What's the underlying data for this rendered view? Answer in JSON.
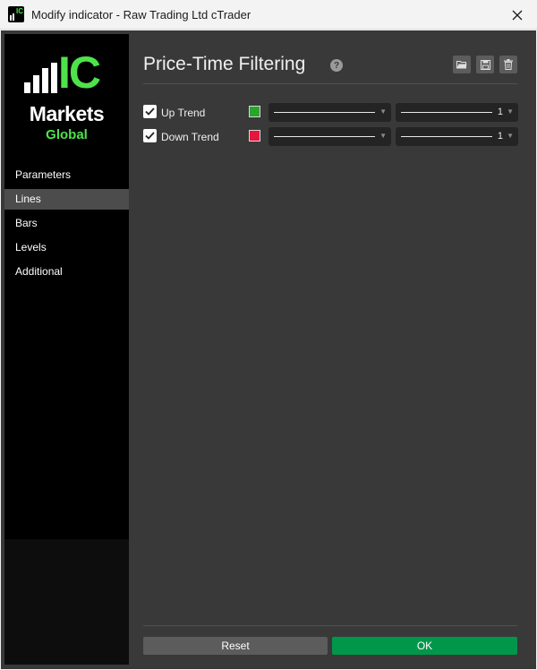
{
  "window": {
    "title": "Modify indicator - Raw Trading Ltd cTrader",
    "close_icon": "close-icon"
  },
  "logo": {
    "ic": "IC",
    "markets": "Markets",
    "global": "Global",
    "brand_green": "#4ee34a"
  },
  "sidebar": {
    "items": [
      {
        "label": "Parameters",
        "active": false
      },
      {
        "label": "Lines",
        "active": true
      },
      {
        "label": "Bars",
        "active": false
      },
      {
        "label": "Levels",
        "active": false
      },
      {
        "label": "Additional",
        "active": false
      }
    ]
  },
  "header": {
    "title": "Price-Time Filtering",
    "help_icon": "help-icon",
    "tools": [
      "open-folder-icon",
      "save-icon",
      "delete-icon"
    ]
  },
  "lines": [
    {
      "label": "Up Trend",
      "checked": true,
      "color": "#27a52d",
      "style": "solid",
      "thickness": "1"
    },
    {
      "label": "Down Trend",
      "checked": true,
      "color": "#e5173f",
      "style": "solid",
      "thickness": "1"
    }
  ],
  "footer": {
    "reset_label": "Reset",
    "ok_label": "OK",
    "ok_color": "#00974b"
  }
}
